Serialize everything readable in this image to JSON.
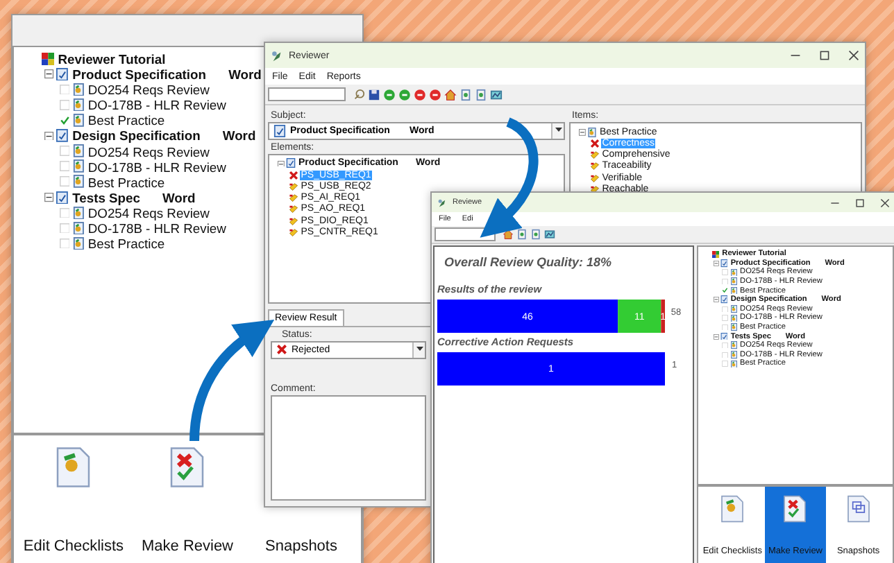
{
  "checklist_panel": {
    "tree": [
      {
        "kind": "root",
        "name": "Reviewer Tutorial",
        "children": [
          {
            "kind": "document",
            "name": "Product Specification",
            "format": "Word",
            "expanded": true,
            "children": [
              {
                "kind": "checklist",
                "name": "DO254 Reqs Review",
                "checked": false
              },
              {
                "kind": "checklist",
                "name": "DO-178B - HLR Review",
                "checked": false
              },
              {
                "kind": "checklist",
                "name": "Best Practice",
                "checked": true
              }
            ]
          },
          {
            "kind": "document",
            "name": "Design Specification",
            "format": "Word",
            "expanded": true,
            "children": [
              {
                "kind": "checklist",
                "name": "DO254 Reqs Review",
                "checked": false
              },
              {
                "kind": "checklist",
                "name": "DO-178B - HLR Review",
                "checked": false
              },
              {
                "kind": "checklist",
                "name": "Best Practice",
                "checked": false
              }
            ]
          },
          {
            "kind": "document",
            "name": "Tests Spec",
            "format": "Word",
            "expanded": true,
            "children": [
              {
                "kind": "checklist",
                "name": "DO254 Reqs Review",
                "checked": false
              },
              {
                "kind": "checklist",
                "name": "DO-178B - HLR Review",
                "checked": false
              },
              {
                "kind": "checklist",
                "name": "Best Practice",
                "checked": false
              }
            ]
          }
        ]
      }
    ],
    "toolbar": [
      {
        "kind": "checklists",
        "label": "Edit Checklists",
        "selected": false
      },
      {
        "kind": "review",
        "label": "Make Review",
        "selected": false
      },
      {
        "label": "Snapshots",
        "selected": false
      }
    ]
  },
  "reviewer_window": {
    "title": "Reviewer",
    "menu": [
      "File",
      "Edit",
      "Reports"
    ],
    "subject": {
      "label": "Subject:",
      "value": {
        "name": "Product Specification",
        "format": "Word"
      }
    },
    "elements": {
      "label": "Elements:",
      "tree": [
        {
          "kind": "document",
          "name": "Product Specification",
          "format": "Word",
          "expanded": true,
          "children": [
            {
              "kind": "element",
              "name": "PS_USB_REQ1",
              "rejected": true,
              "selected": true
            },
            {
              "kind": "element",
              "name": "PS_USB_REQ2",
              "rejected": false,
              "selected": false
            },
            {
              "kind": "element",
              "name": "PS_AI_REQ1",
              "rejected": false,
              "selected": false
            },
            {
              "kind": "element",
              "name": "PS_AO_REQ1",
              "rejected": false,
              "selected": false
            },
            {
              "kind": "element",
              "name": "PS_DIO_REQ1",
              "rejected": false,
              "selected": false
            },
            {
              "kind": "element",
              "name": "PS_CNTR_REQ1",
              "rejected": false,
              "selected": false
            }
          ]
        }
      ]
    },
    "items": {
      "label": "Items:",
      "tree": [
        {
          "kind": "checklist_root",
          "name": "Best Practice",
          "expanded": true,
          "children": [
            {
              "kind": "element",
              "name": "Correctness",
              "rejected": true,
              "selected": true
            },
            {
              "kind": "element",
              "name": "Comprehensive",
              "rejected": false,
              "selected": false
            },
            {
              "kind": "element",
              "name": "Traceability",
              "rejected": false,
              "selected": false
            },
            {
              "kind": "element",
              "name": "Verifiable",
              "rejected": false,
              "selected": false
            },
            {
              "kind": "element",
              "name": "Reachable",
              "rejected": false,
              "selected": false
            }
          ]
        }
      ]
    },
    "tabs": [
      {
        "label": "Review Result",
        "selected": true
      }
    ],
    "status": {
      "label": "Status:",
      "value": "Rejected",
      "rejected": true
    },
    "comment": {
      "label": "Comment:"
    }
  },
  "report_window": {
    "title": "Reviewe",
    "menu": [
      "File",
      "Edi"
    ],
    "heading": "Overall Review Quality: 18%",
    "charts": [
      {
        "chart_data": {
          "type": "bar",
          "title": "Results of the review",
          "orientation": "horizontal",
          "stacked": true,
          "categories": [
            null
          ],
          "data_labels": true,
          "series": [
            {
              "color": "#0000ff",
              "values": [
                46
              ]
            },
            {
              "color": "#33cc33",
              "values": [
                11
              ]
            },
            {
              "color": "#cc2222",
              "values": [
                1
              ]
            }
          ],
          "annotations": [
            "58"
          ]
        }
      }
    ],
    "corrective_actions": {
      "title": "Corrective Action Requests",
      "bar_label": "1",
      "total": "1"
    },
    "tree": [
      {
        "kind": "root",
        "name": "Reviewer Tutorial",
        "children": [
          {
            "kind": "document",
            "name": "Product Specification",
            "format": "Word",
            "expanded": true,
            "children": [
              {
                "kind": "checklist",
                "name": "DO254 Reqs Review",
                "checked": false
              },
              {
                "kind": "checklist",
                "name": "DO-178B - HLR Review",
                "checked": false
              },
              {
                "kind": "checklist",
                "name": "Best Practice",
                "checked": true
              }
            ]
          },
          {
            "kind": "document",
            "name": "Design Specification",
            "format": "Word",
            "expanded": true,
            "children": [
              {
                "kind": "checklist",
                "name": "DO254 Reqs Review",
                "checked": false
              },
              {
                "kind": "checklist",
                "name": "DO-178B - HLR Review",
                "checked": false
              },
              {
                "kind": "checklist",
                "name": "Best Practice",
                "checked": false
              }
            ]
          },
          {
            "kind": "document",
            "name": "Tests Spec",
            "format": "Word",
            "expanded": true,
            "children": [
              {
                "kind": "checklist",
                "name": "DO254 Reqs Review",
                "checked": false
              },
              {
                "kind": "checklist",
                "name": "DO-178B - HLR Review",
                "checked": false
              },
              {
                "kind": "checklist",
                "name": "Best Practice",
                "checked": false
              }
            ]
          }
        ]
      }
    ],
    "toolbar": [
      {
        "kind": "checklists",
        "label": "Edit Checklists",
        "selected": false
      },
      {
        "kind": "review",
        "label": "Make Review",
        "selected": true
      },
      {
        "kind": "snapshots",
        "label": "Snapshots",
        "selected": false
      }
    ]
  }
}
